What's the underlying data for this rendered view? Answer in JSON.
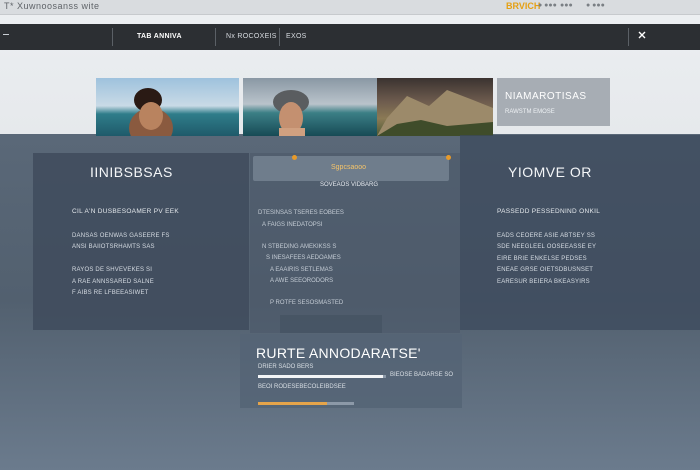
{
  "topbar": {
    "title": "T* Xuwnoosanss wite",
    "brand": "BRVICH",
    "links": [
      "● ●●●",
      "●●●",
      "●  ●●●"
    ]
  },
  "nav": {
    "items": [
      "TAB  ANNIVA",
      "Nx ROCOXEIS",
      "EXOS"
    ],
    "icon": "close-icon"
  },
  "hero": {
    "card_title": "NIAMAROTISAS",
    "card_sub": "RAWSTM EMOSE"
  },
  "left_panel": {
    "heading": "IINIBSBSAS",
    "sub": "CIL A'N DUSBESOAMER PV EEK",
    "lines": [
      "DANSAS OENWAS GASEERE FS",
      "ANSI BAIIOTSRHAMTS SAS",
      "RAYOS DE  SHVEVEKES  SI",
      "A RAE ANNSSARED SALNE",
      "F AIBS RE LFBEEASIWET"
    ]
  },
  "mid_panel": {
    "search_text": "Sgpcsaooo",
    "sub": "SOVEAOS  VIDBARG",
    "lines": [
      "DTESINSAS  TSERES  EOBEES",
      "A  FAIGS  INEDATOPSI",
      "N  STBEDING  AMEKIKSS  S",
      "S  INESAFEES  AEDOAMES",
      "A  EAAIRIS  SETLEMAS",
      "A  AWE  SEEORODORS",
      "P  ROTFE  SESOSMASTED"
    ]
  },
  "right_panel": {
    "heading": "YIOMVE OR",
    "sub": "PASSEDD PESSEDNIND ONKIL",
    "lines": [
      "EADS CEOERE ASIE ABTSEY SS",
      "SDE NEEGLEEL OOSEEASSE EY",
      "EIRE BRIE ENKELSE PEDSES",
      "ENEAE GRSE OIETSDBUSNSET",
      "EARESUR BEIERA BKEASYIRS"
    ]
  },
  "bottom_box": {
    "heading": "RURTE ANNODARATSE'",
    "line1": "DRIER SADO BERS",
    "line2": "BEOI RODESEBECOLEIBDSEE",
    "line3": "BIEOSE BADARSE SO",
    "progress_white": 0.98,
    "progress_orange": 0.72,
    "accent": "#e5a44a"
  }
}
